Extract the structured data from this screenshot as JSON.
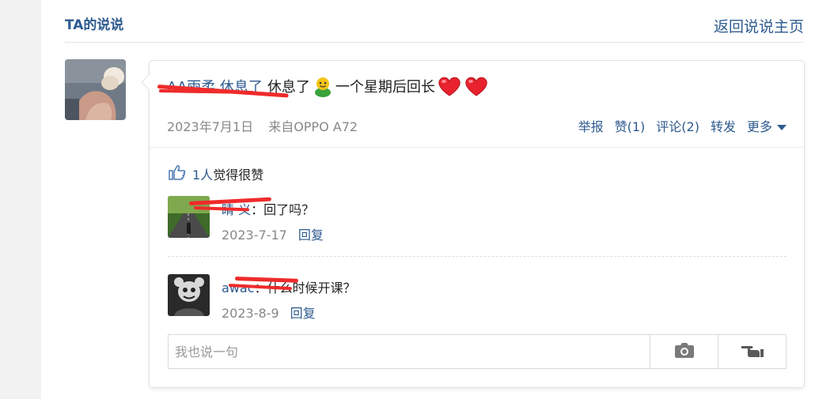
{
  "header": {
    "title": "TA的说说",
    "back_label": "返回说说主页"
  },
  "post": {
    "author": "AA雨柔 休息了",
    "text": "休息了",
    "text_after": "一个星期后回长",
    "date": "2023年7月1日",
    "source": "来自OPPO A72",
    "actions": {
      "report": "举报",
      "like": "赞(1)",
      "comment": "评论(2)",
      "forward": "转发",
      "more": "更多"
    }
  },
  "likes": {
    "count": "1人",
    "text": "觉得很赞"
  },
  "comments": [
    {
      "name": "睛 义",
      "text": "：回了吗？",
      "date": "2023-7-17",
      "reply": "回复"
    },
    {
      "name": "awac",
      "text": "：什么时候开课？",
      "date": "2023-8-9",
      "reply": "回复"
    }
  ],
  "comment_box": {
    "placeholder": "我也说一句"
  },
  "icons": [
    "thumbs-up-icon",
    "camera-icon",
    "pointing-hand-icon",
    "chevron-down-icon"
  ],
  "colors": {
    "link_blue": "#2d5a8f",
    "meta_gray": "#888888",
    "scribble_red": "#ef2b2b",
    "heart_red": "#e8232f"
  }
}
